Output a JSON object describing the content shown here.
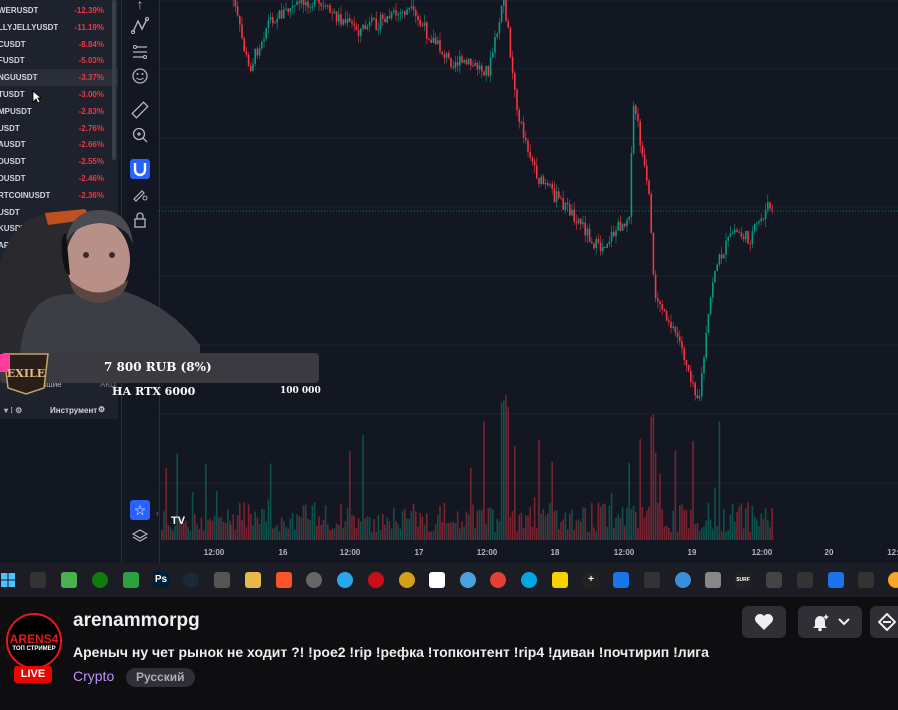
{
  "watchlist": {
    "rows": [
      {
        "symbol": "WERUSDT",
        "change": "-12.39%"
      },
      {
        "symbol": "LLYJELLYUSDT",
        "change": "-11.19%"
      },
      {
        "symbol": "CUSDT",
        "change": "-8.84%"
      },
      {
        "symbol": "FUSDT",
        "change": "-5.03%"
      },
      {
        "symbol": "NGUUSDT",
        "change": "-3.37%"
      },
      {
        "symbol": "TUSDT",
        "change": "-3.00%"
      },
      {
        "symbol": "MPUSDT",
        "change": "-2.83%"
      },
      {
        "symbol": "USDT",
        "change": "-2.76%"
      },
      {
        "symbol": "AUSDT",
        "change": "-2.66%"
      },
      {
        "symbol": "DUSDT",
        "change": "-2.55%"
      },
      {
        "symbol": "DUSDT",
        "change": "-2.46%"
      },
      {
        "symbol": "RTCOINUSDT",
        "change": "-2.36%"
      },
      {
        "symbol": "USDT",
        "change": ""
      },
      {
        "symbol": "KUSDT",
        "change": ""
      },
      {
        "symbol": "ARUSDT",
        "change": ""
      }
    ],
    "header_instrument": "Инструмент",
    "tab_left": "тавшие",
    "tab_right": "АКЦ"
  },
  "chart": {
    "x_labels": [
      "12:00",
      "16",
      "12:00",
      "17",
      "12:00",
      "18",
      "12:00",
      "19",
      "12:00",
      "20",
      "12:"
    ],
    "logo": "TV"
  },
  "donation": {
    "amount": "7 800 RUB (8%)",
    "subtitle": "НА RTX 6000",
    "goal": "100 000",
    "game_logo": "PATH OF EXILE"
  },
  "stream_info": {
    "channel_name": "arenammorpg",
    "title": "Ареныч ну чет рынок не ходит ?! !poe2 !rip !рефка !топконтент !rip4 !диван !почтирип !лига",
    "category": "Crypto",
    "tag": "Русский",
    "live_label": "LIVE",
    "avatar_text_1": "ARENS4",
    "avatar_text_2": "ТОП СТРИМЕР"
  },
  "colors": {
    "down": "#f23645",
    "up": "#089981",
    "accent": "#2962ff",
    "twitch_purple": "#bf94ff",
    "live_red": "#eb0400"
  }
}
